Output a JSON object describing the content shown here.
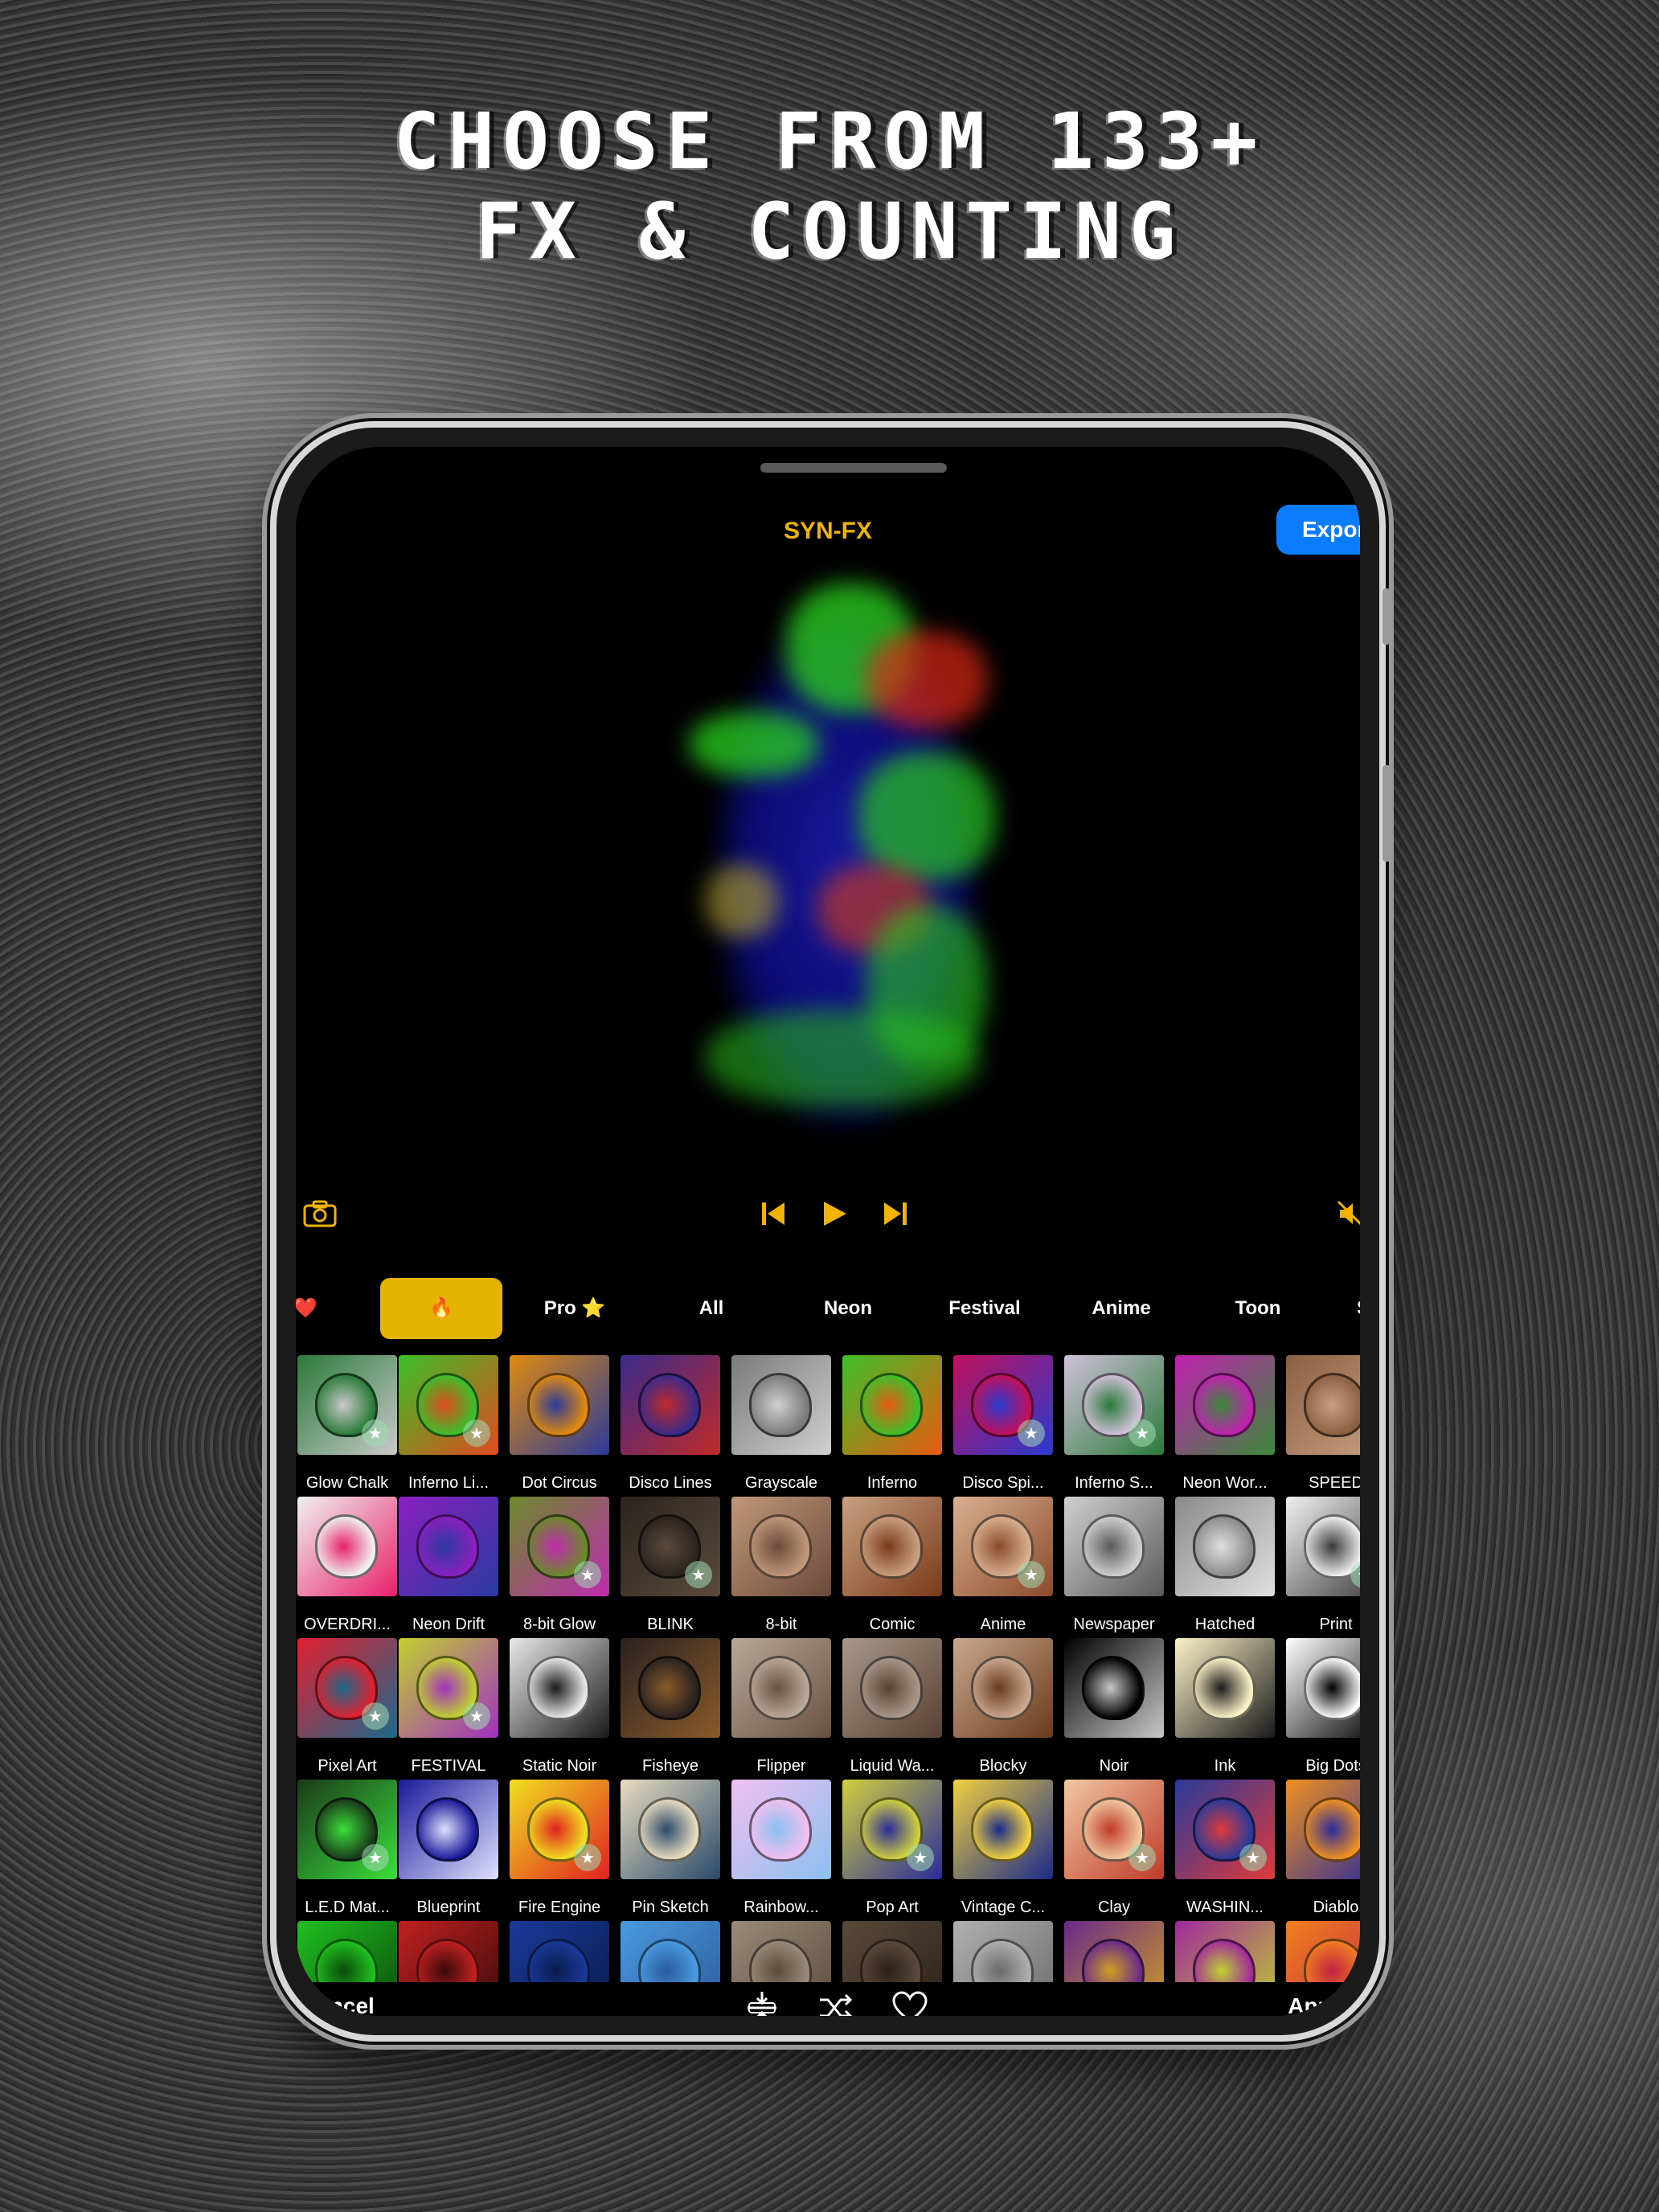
{
  "headline": {
    "line1": "CHOOSE FROM 133+",
    "line2": "FX & COUNTING"
  },
  "app": {
    "title": "SYN-FX",
    "export_label": "Export"
  },
  "controls": {
    "camera_icon": "camera-icon",
    "prev_icon": "skip-back-icon",
    "play_icon": "play-icon",
    "next_icon": "skip-forward-icon",
    "mute_icon": "speaker-muted-icon"
  },
  "categories": [
    {
      "label": "❤️",
      "active": false
    },
    {
      "label": "🔥",
      "active": true
    },
    {
      "label": "Pro ⭐",
      "active": false
    },
    {
      "label": "All",
      "active": false
    },
    {
      "label": "Neon",
      "active": false
    },
    {
      "label": "Festival",
      "active": false
    },
    {
      "label": "Anime",
      "active": false
    },
    {
      "label": "Toon",
      "active": false
    },
    {
      "label": "S",
      "active": false
    }
  ],
  "effects": [
    {
      "label": "Glow Chalk",
      "color": "#2a7a3a",
      "color2": "#c9c9c9",
      "badge": true
    },
    {
      "label": "Inferno Li...",
      "color": "#3bbf2a",
      "color2": "#e0491f",
      "badge": true
    },
    {
      "label": "Dot Circus",
      "color": "#e08a10",
      "color2": "#2a3a9a",
      "badge": false
    },
    {
      "label": "Disco Lines",
      "color": "#3a2a8a",
      "color2": "#c02a2a",
      "badge": false
    },
    {
      "label": "Grayscale",
      "color": "#7a7a7a",
      "color2": "#d0d0d0",
      "badge": false
    },
    {
      "label": "Inferno",
      "color": "#3fbf2a",
      "color2": "#e85a10",
      "badge": false
    },
    {
      "label": "Disco Spi...",
      "color": "#c0105a",
      "color2": "#2a3acf",
      "badge": true
    },
    {
      "label": "Inferno S...",
      "color": "#d0c0d8",
      "color2": "#2a7a3a",
      "badge": true
    },
    {
      "label": "Neon Wor...",
      "color": "#c020b0",
      "color2": "#3a8a3a",
      "badge": false
    },
    {
      "label": "SPEED",
      "color": "#8a6040",
      "color2": "#c8a080",
      "badge": false
    },
    {
      "label": "OVERDRI...",
      "color": "#f0f0f0",
      "color2": "#e8206a",
      "badge": false
    },
    {
      "label": "Neon Drift",
      "color": "#8a20c0",
      "color2": "#2a3aa0",
      "badge": false
    },
    {
      "label": "8-bit Glow",
      "color": "#6a8a2a",
      "color2": "#c02ab0",
      "badge": true
    },
    {
      "label": "BLINK",
      "color": "#2a2420",
      "color2": "#5a4a3a",
      "badge": true
    },
    {
      "label": "8-bit",
      "color": "#c0987a",
      "color2": "#6a4a3a",
      "badge": false
    },
    {
      "label": "Comic",
      "color": "#c8a080",
      "color2": "#7a3a1a",
      "badge": false
    },
    {
      "label": "Anime",
      "color": "#d8b090",
      "color2": "#8a4a2a",
      "badge": true
    },
    {
      "label": "Newspaper",
      "color": "#d0d0d0",
      "color2": "#5a5a5a",
      "badge": false
    },
    {
      "label": "Hatched",
      "color": "#8a8a8a",
      "color2": "#e0e0e0",
      "badge": false
    },
    {
      "label": "Print",
      "color": "#f0f0f0",
      "color2": "#3a3a3a",
      "badge": true
    },
    {
      "label": "Pixel Art",
      "color": "#e02030",
      "color2": "#1a6a8a",
      "badge": true
    },
    {
      "label": "FESTIVAL",
      "color": "#c0d030",
      "color2": "#a030c0",
      "badge": true
    },
    {
      "label": "Static Noir",
      "color": "#e8e8e8",
      "color2": "#1a1a1a",
      "badge": false
    },
    {
      "label": "Fisheye",
      "color": "#2a2220",
      "color2": "#8a5a2a",
      "badge": false
    },
    {
      "label": "Flipper",
      "color": "#b8a898",
      "color2": "#6a5040",
      "badge": false
    },
    {
      "label": "Liquid Wa...",
      "color": "#a8988a",
      "color2": "#5a4030",
      "badge": false
    },
    {
      "label": "Blocky",
      "color": "#c8a890",
      "color2": "#6a3a1a",
      "badge": false
    },
    {
      "label": "Noir",
      "color": "#000000",
      "color2": "#c8c8c8",
      "badge": false
    },
    {
      "label": "Ink",
      "color": "#fbf2c8",
      "color2": "#1a1a1a",
      "badge": false
    },
    {
      "label": "Big Dots",
      "color": "#ffffff",
      "color2": "#000000",
      "badge": false
    },
    {
      "label": "L.E.D Mat...",
      "color": "#1a3a1a",
      "color2": "#3adf3a",
      "badge": true
    },
    {
      "label": "Blueprint",
      "color": "#1a1a9a",
      "color2": "#e0e0ff",
      "badge": false
    },
    {
      "label": "Fire Engine",
      "color": "#f0e020",
      "color2": "#e02020",
      "badge": true
    },
    {
      "label": "Pin Sketch",
      "color": "#e8dcc0",
      "color2": "#2a4a6a",
      "badge": false
    },
    {
      "label": "Rainbow...",
      "color": "#f0c0f0",
      "color2": "#8ac0f0",
      "badge": false
    },
    {
      "label": "Pop Art",
      "color": "#d0d040",
      "color2": "#2a2a9a",
      "badge": true
    },
    {
      "label": "Vintage C...",
      "color": "#f0d040",
      "color2": "#1a2a8a",
      "badge": false
    },
    {
      "label": "Clay",
      "color": "#f0c8a0",
      "color2": "#c03a2a",
      "badge": true
    },
    {
      "label": "WASHIN...",
      "color": "#2a3a9a",
      "color2": "#e03a3a",
      "badge": true
    },
    {
      "label": "Diablo",
      "color": "#f09020",
      "color2": "#2a2a9a",
      "badge": false
    },
    {
      "label": "",
      "color": "#20c020",
      "color2": "#0a4a0a",
      "badge": false
    },
    {
      "label": "",
      "color": "#c02020",
      "color2": "#3a0a0a",
      "badge": false
    },
    {
      "label": "",
      "color": "#1a3a9a",
      "color2": "#0a1a4a",
      "badge": false
    },
    {
      "label": "",
      "color": "#4a9ae0",
      "color2": "#2a5a9a",
      "badge": false
    },
    {
      "label": "",
      "color": "#9a8a7a",
      "color2": "#5a4a3a",
      "badge": false
    },
    {
      "label": "",
      "color": "#5a4a3a",
      "color2": "#2a2018",
      "badge": false
    },
    {
      "label": "",
      "color": "#b0b0b0",
      "color2": "#6a6a6a",
      "badge": false
    },
    {
      "label": "",
      "color": "#6a2a8a",
      "color2": "#d0a020",
      "badge": false
    },
    {
      "label": "",
      "color": "#a02a9a",
      "color2": "#c0d030",
      "badge": false
    },
    {
      "label": "",
      "color": "#f08020",
      "color2": "#c02040",
      "badge": false
    }
  ],
  "bottom": {
    "cancel": "Cancel",
    "apply": "Apply",
    "icons": [
      "split-icon",
      "shuffle-icon",
      "heart-icon"
    ]
  }
}
